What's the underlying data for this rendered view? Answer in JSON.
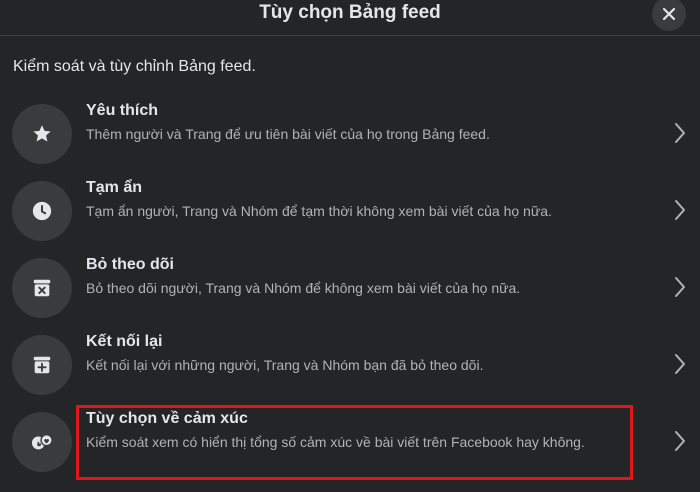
{
  "dialog": {
    "title": "Tùy chọn Bảng feed",
    "subtitle": "Kiểm soát và tùy chỉnh Bảng feed."
  },
  "options": [
    {
      "title": "Yêu thích",
      "description": "Thêm người và Trang để ưu tiên bài viết của họ trong Bảng feed.",
      "icon": "star-icon"
    },
    {
      "title": "Tạm ẩn",
      "description": "Tạm ẩn người, Trang và Nhóm để tạm thời không xem bài viết của họ nữa.",
      "icon": "clock-icon"
    },
    {
      "title": "Bỏ theo dõi",
      "description": "Bỏ theo dõi người, Trang và Nhóm để không xem bài viết của họ nữa.",
      "icon": "unfollow-box-icon"
    },
    {
      "title": "Kết nối lại",
      "description": "Kết nối lại với những người, Trang và Nhóm bạn đã bỏ theo dõi.",
      "icon": "reconnect-box-icon"
    },
    {
      "title": "Tùy chọn về cảm xúc",
      "description": "Kiểm soát xem có hiển thị tổng số cảm xúc về bài viết trên Facebook hay không.",
      "icon": "reactions-icon"
    }
  ],
  "colors": {
    "background": "#242526",
    "icon_circle": "#3a3b3c",
    "primary_text": "#e4e6eb",
    "secondary_text": "#b0b3b8",
    "highlight_border": "#e0161c"
  }
}
